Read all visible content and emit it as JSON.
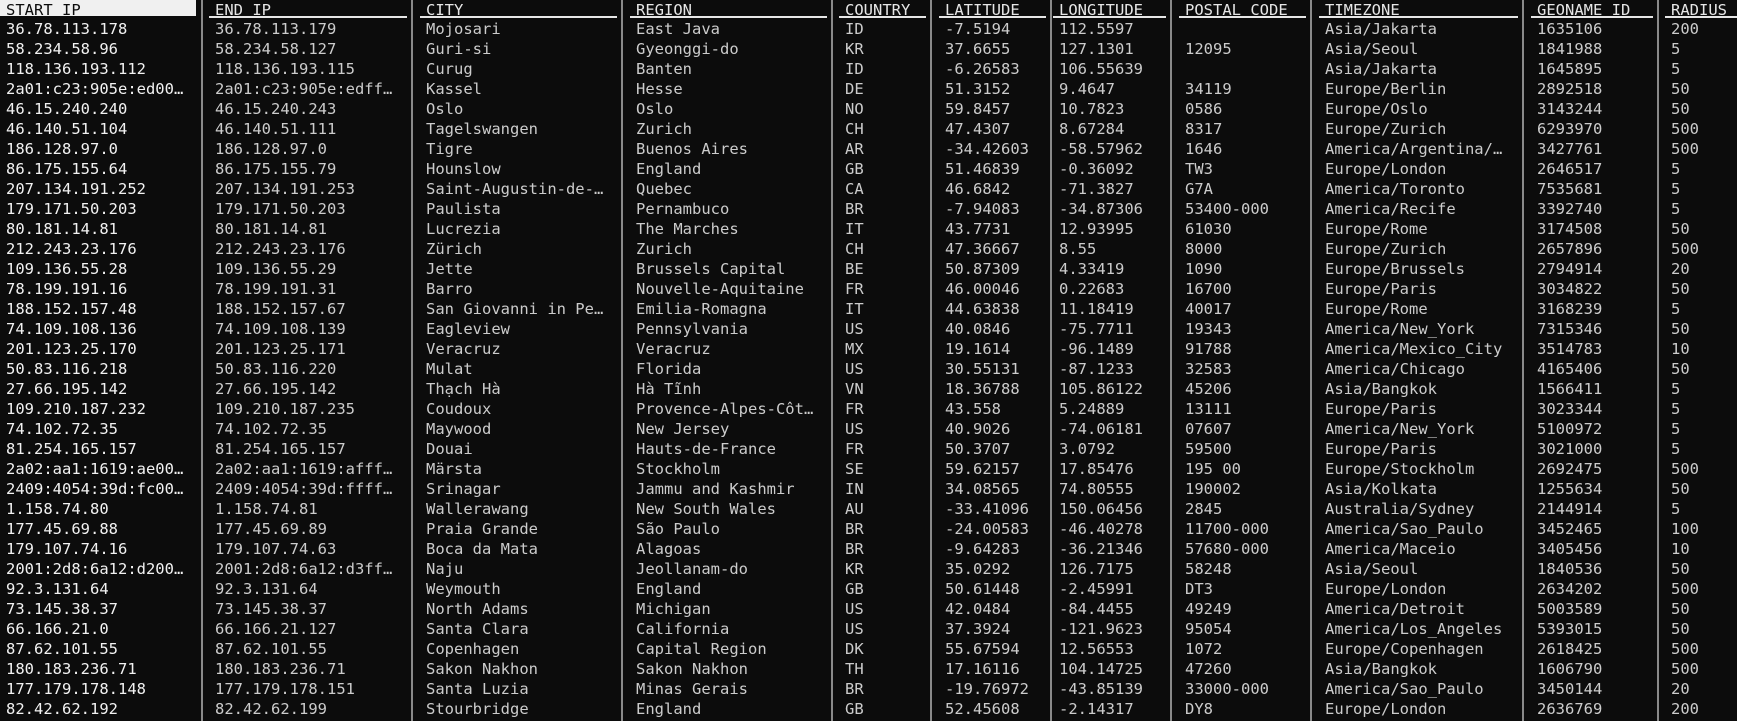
{
  "columns": [
    "START_IP",
    "END_IP",
    "CITY",
    "REGION",
    "COUNTRY",
    "LATITUDE",
    "LONGITUDE",
    "POSTAL_CODE",
    "TIMEZONE",
    "GEONAME_ID",
    "RADIUS"
  ],
  "selected_column": "START_IP",
  "rows": [
    [
      "36.78.113.178",
      "36.78.113.179",
      "Mojosari",
      "East Java",
      "ID",
      "-7.5194",
      "112.5597",
      "",
      "Asia/Jakarta",
      "1635106",
      "200"
    ],
    [
      "58.234.58.96",
      "58.234.58.127",
      "Guri-si",
      "Gyeonggi-do",
      "KR",
      "37.6655",
      "127.1301",
      "12095",
      "Asia/Seoul",
      "1841988",
      "5"
    ],
    [
      "118.136.193.112",
      "118.136.193.115",
      "Curug",
      "Banten",
      "ID",
      "-6.26583",
      "106.55639",
      "",
      "Asia/Jakarta",
      "1645895",
      "5"
    ],
    [
      "2a01:c23:905e:ed00…",
      "2a01:c23:905e:edff…",
      "Kassel",
      "Hesse",
      "DE",
      "51.3152",
      "9.4647",
      "34119",
      "Europe/Berlin",
      "2892518",
      "50"
    ],
    [
      "46.15.240.240",
      "46.15.240.243",
      "Oslo",
      "Oslo",
      "NO",
      "59.8457",
      "10.7823",
      "0586",
      "Europe/Oslo",
      "3143244",
      "50"
    ],
    [
      "46.140.51.104",
      "46.140.51.111",
      "Tagelswangen",
      "Zurich",
      "CH",
      "47.4307",
      "8.67284",
      "8317",
      "Europe/Zurich",
      "6293970",
      "500"
    ],
    [
      "186.128.97.0",
      "186.128.97.0",
      "Tigre",
      "Buenos Aires",
      "AR",
      "-34.42603",
      "-58.57962",
      "1646",
      "America/Argentina/…",
      "3427761",
      "500"
    ],
    [
      "86.175.155.64",
      "86.175.155.79",
      "Hounslow",
      "England",
      "GB",
      "51.46839",
      "-0.36092",
      "TW3",
      "Europe/London",
      "2646517",
      "5"
    ],
    [
      "207.134.191.252",
      "207.134.191.253",
      "Saint-Augustin-de-…",
      "Quebec",
      "CA",
      "46.6842",
      "-71.3827",
      "G7A",
      "America/Toronto",
      "7535681",
      "5"
    ],
    [
      "179.171.50.203",
      "179.171.50.203",
      "Paulista",
      "Pernambuco",
      "BR",
      "-7.94083",
      "-34.87306",
      "53400-000",
      "America/Recife",
      "3392740",
      "5"
    ],
    [
      "80.181.14.81",
      "80.181.14.81",
      "Lucrezia",
      "The Marches",
      "IT",
      "43.7731",
      "12.93995",
      "61030",
      "Europe/Rome",
      "3174508",
      "50"
    ],
    [
      "212.243.23.176",
      "212.243.23.176",
      "Zürich",
      "Zurich",
      "CH",
      "47.36667",
      "8.55",
      "8000",
      "Europe/Zurich",
      "2657896",
      "500"
    ],
    [
      "109.136.55.28",
      "109.136.55.29",
      "Jette",
      "Brussels Capital",
      "BE",
      "50.87309",
      "4.33419",
      "1090",
      "Europe/Brussels",
      "2794914",
      "20"
    ],
    [
      "78.199.191.16",
      "78.199.191.31",
      "Barro",
      "Nouvelle-Aquitaine",
      "FR",
      "46.00046",
      "0.22683",
      "16700",
      "Europe/Paris",
      "3034822",
      "50"
    ],
    [
      "188.152.157.48",
      "188.152.157.67",
      "San Giovanni in Pe…",
      "Emilia-Romagna",
      "IT",
      "44.63838",
      "11.18419",
      "40017",
      "Europe/Rome",
      "3168239",
      "5"
    ],
    [
      "74.109.108.136",
      "74.109.108.139",
      "Eagleview",
      "Pennsylvania",
      "US",
      "40.0846",
      "-75.7711",
      "19343",
      "America/New_York",
      "7315346",
      "50"
    ],
    [
      "201.123.25.170",
      "201.123.25.171",
      "Veracruz",
      "Veracruz",
      "MX",
      "19.1614",
      "-96.1489",
      "91788",
      "America/Mexico_City",
      "3514783",
      "10"
    ],
    [
      "50.83.116.218",
      "50.83.116.220",
      "Mulat",
      "Florida",
      "US",
      "30.55131",
      "-87.1233",
      "32583",
      "America/Chicago",
      "4165406",
      "50"
    ],
    [
      "27.66.195.142",
      "27.66.195.142",
      "Thạch Hà",
      "Hà Tĩnh",
      "VN",
      "18.36788",
      "105.86122",
      "45206",
      "Asia/Bangkok",
      "1566411",
      "5"
    ],
    [
      "109.210.187.232",
      "109.210.187.235",
      "Coudoux",
      "Provence-Alpes-Côt…",
      "FR",
      "43.558",
      "5.24889",
      "13111",
      "Europe/Paris",
      "3023344",
      "5"
    ],
    [
      "74.102.72.35",
      "74.102.72.35",
      "Maywood",
      "New Jersey",
      "US",
      "40.9026",
      "-74.06181",
      "07607",
      "America/New_York",
      "5100972",
      "5"
    ],
    [
      "81.254.165.157",
      "81.254.165.157",
      "Douai",
      "Hauts-de-France",
      "FR",
      "50.3707",
      "3.0792",
      "59500",
      "Europe/Paris",
      "3021000",
      "5"
    ],
    [
      "2a02:aa1:1619:ae00…",
      "2a02:aa1:1619:afff…",
      "Märsta",
      "Stockholm",
      "SE",
      "59.62157",
      "17.85476",
      "195 00",
      "Europe/Stockholm",
      "2692475",
      "500"
    ],
    [
      "2409:4054:39d:fc00…",
      "2409:4054:39d:ffff…",
      "Srinagar",
      "Jammu and Kashmir",
      "IN",
      "34.08565",
      "74.80555",
      "190002",
      "Asia/Kolkata",
      "1255634",
      "50"
    ],
    [
      "1.158.74.80",
      "1.158.74.81",
      "Wallerawang",
      "New South Wales",
      "AU",
      "-33.41096",
      "150.06456",
      "2845",
      "Australia/Sydney",
      "2144914",
      "5"
    ],
    [
      "177.45.69.88",
      "177.45.69.89",
      "Praia Grande",
      "São Paulo",
      "BR",
      "-24.00583",
      "-46.40278",
      "11700-000",
      "America/Sao_Paulo",
      "3452465",
      "100"
    ],
    [
      "179.107.74.16",
      "179.107.74.63",
      "Boca da Mata",
      "Alagoas",
      "BR",
      "-9.64283",
      "-36.21346",
      "57680-000",
      "America/Maceio",
      "3405456",
      "10"
    ],
    [
      "2001:2d8:6a12:d200…",
      "2001:2d8:6a12:d3ff…",
      "Naju",
      "Jeollanam-do",
      "KR",
      "35.0292",
      "126.7175",
      "58248",
      "Asia/Seoul",
      "1840536",
      "50"
    ],
    [
      "92.3.131.64",
      "92.3.131.64",
      "Weymouth",
      "England",
      "GB",
      "50.61448",
      "-2.45991",
      "DT3",
      "Europe/London",
      "2634202",
      "500"
    ],
    [
      "73.145.38.37",
      "73.145.38.37",
      "North Adams",
      "Michigan",
      "US",
      "42.0484",
      "-84.4455",
      "49249",
      "America/Detroit",
      "5003589",
      "50"
    ],
    [
      "66.166.21.0",
      "66.166.21.127",
      "Santa Clara",
      "California",
      "US",
      "37.3924",
      "-121.9623",
      "95054",
      "America/Los_Angeles",
      "5393015",
      "50"
    ],
    [
      "87.62.101.55",
      "87.62.101.55",
      "Copenhagen",
      "Capital Region",
      "DK",
      "55.67594",
      "12.56553",
      "1072",
      "Europe/Copenhagen",
      "2618425",
      "500"
    ],
    [
      "180.183.236.71",
      "180.183.236.71",
      "Sakon Nakhon",
      "Sakon Nakhon",
      "TH",
      "17.16116",
      "104.14725",
      "47260",
      "Asia/Bangkok",
      "1606790",
      "500"
    ],
    [
      "177.179.178.148",
      "177.179.178.151",
      "Santa Luzia",
      "Minas Gerais",
      "BR",
      "-19.76972",
      "-43.85139",
      "33000-000",
      "America/Sao_Paulo",
      "3450144",
      "20"
    ],
    [
      "82.42.62.192",
      "82.42.62.199",
      "Stourbridge",
      "England",
      "GB",
      "52.45608",
      "-2.14317",
      "DY8",
      "Europe/London",
      "2636769",
      "200"
    ]
  ]
}
